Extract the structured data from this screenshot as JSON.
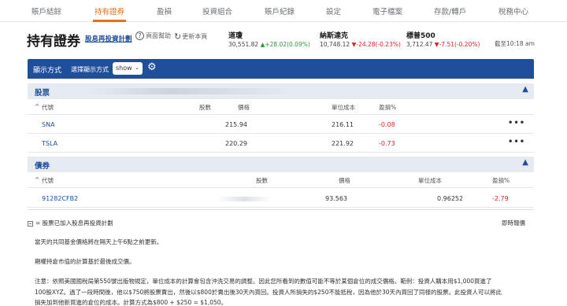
{
  "nav": {
    "items": [
      "賬戶結餘",
      "持有證券",
      "盈損",
      "投資組合",
      "賬戶紀錄",
      "設定",
      "電子檔案",
      "存款/轉戶",
      "稅務中心"
    ],
    "active_index": 1,
    "active_color": "#e8701a"
  },
  "header": {
    "title": "持有證券",
    "drip_link": "股息再投資計劃",
    "help": "頁面幫助",
    "refresh": "更新本頁",
    "as_of": "截至10:18 am",
    "indices": [
      {
        "name": "道瓊",
        "value": "30,551.82",
        "change": "+28.02(0.09%)",
        "direction": "up",
        "arrow": "▲"
      },
      {
        "name": "納斯達克",
        "value": "10,748.12",
        "change": "-24.28(-0.23%)",
        "direction": "down",
        "arrow": "▼"
      },
      {
        "name": "標普500",
        "value": "3,712.47",
        "change": "-7.51(-0.20%)",
        "direction": "down",
        "arrow": "▼"
      }
    ]
  },
  "toolbar": {
    "display_label": "顯示方式",
    "view_label": "選擇顯示方式",
    "select_value": "show",
    "icons": [
      "chevron-down-icon",
      "gear-icon"
    ],
    "bg_color": "#1f4e9a"
  },
  "stocks": {
    "label": "股票",
    "columns": [
      "代號",
      "股數",
      "價格",
      "單位成本",
      "盈損%"
    ],
    "rows": [
      {
        "symbol": "SNA",
        "price": "215.94",
        "unit_cost": "216.11",
        "gain_pct": "-0.08",
        "more": "•••"
      },
      {
        "symbol": "TSLA",
        "price": "220.29",
        "unit_cost": "221.92",
        "gain_pct": "-0.73",
        "more": "•••"
      }
    ]
  },
  "bonds": {
    "label": "債券",
    "columns": [
      "代號",
      "股數",
      "價格",
      "單位成本",
      "盈損%"
    ],
    "rows": [
      {
        "symbol": "91282CFB2",
        "price": "93.563",
        "unit_cost": "0.96252",
        "gain_pct": "-2.79"
      }
    ]
  },
  "footer": {
    "legend": "= 股票已加入股息再投資計劃",
    "realtime": "即時報價",
    "note1": "當天的共同基金價格將在隔天上午6點之前更新。",
    "note2": "期權持倉市值的計算基於最後成交價。",
    "note3_line1": "注意：依照美國國稅局第550號出版物規定，單位成本的計算會包含沖洗交易的調整。因此您所看到的數值可能不等於某個倉位的成交價格。範例：投資人購本用$1,000買進了",
    "note3_line2": "100股XYZ。過了一段時間後，他以$750將股票賣出，然後以$800於賣出後30天內買回。投資人所損失的$250不能抵稅，因為他於30天內買回了同樣的股票。此投資人可以將此",
    "note3_line3": "損失加到他新買進的倉位的成本。計算方式為$800 + $250 = $1,050。"
  }
}
